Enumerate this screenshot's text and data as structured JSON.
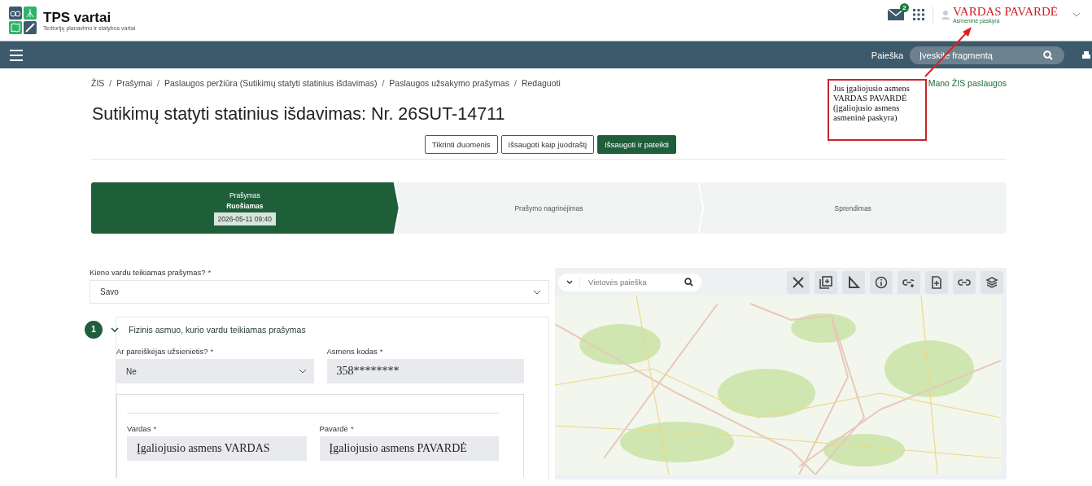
{
  "header": {
    "logo_title": "TPS vartai",
    "logo_subtitle": "Teritorijų planavimo ir statybos vartai",
    "messages_badge": "2",
    "user_name": "VARDAS PAVARDĖ",
    "user_role": "Asmeninė paskyra"
  },
  "navbar": {
    "search_label": "Paieška",
    "search_placeholder": "Įveskite fragmentą"
  },
  "breadcrumbs": [
    "ŽIS",
    "Prašymai",
    "Paslaugos peržiūra (Sutikimų statyti statinius išdavimas)",
    "Paslaugos užsakymo prašymas",
    "Redaguoti"
  ],
  "breadcrumb_separator": "/",
  "side_link": "Mano ŽIS paslaugos",
  "title": "Sutikimų statyti statinius išdavimas: Nr. 26SUT-14711",
  "buttons": [
    {
      "label": "Tikrinti duomenis",
      "kind": "outline"
    },
    {
      "label": "Išsaugoti kaip juodraštį",
      "kind": "outline"
    },
    {
      "label": "Išsaugoti ir pateikti",
      "kind": "primary"
    }
  ],
  "steps": [
    {
      "title": "Prašymas",
      "status": "Ruošiamas",
      "date": "2026-05-11 09:40",
      "selected": true
    },
    {
      "title": "Prašymo nagrinėjimas",
      "selected": false
    },
    {
      "title": "Sprendimas",
      "selected": false
    }
  ],
  "form": {
    "applicant": {
      "label": "Kieno vardu teikiamas prašymas?",
      "mark": "*",
      "value": "Savo"
    },
    "section": {
      "number": "1",
      "title": "Fizinis asmuo, kurio vardu teikiamas prašymas",
      "expanded": true,
      "fields": [
        {
          "label": "Ar pareiškėjas užsienietis?",
          "mark": "*",
          "value": "Ne",
          "kind": "select"
        },
        {
          "label": "Asmens kodas",
          "mark": "*",
          "value": "358********",
          "kind": "text"
        }
      ],
      "subfields": [
        {
          "label": "Vardas",
          "mark": "*",
          "value": "Įgaliojusio asmens VARDAS",
          "kind": "text"
        },
        {
          "label": "Pavardė",
          "mark": "*",
          "value": "Įgaliojusio asmens PAVARDĖ",
          "kind": "text"
        }
      ]
    }
  },
  "map": {
    "search_placeholder": "Vietovės paieška"
  },
  "annotation": {
    "text": "Jus įgaliojusio asmens VARDAS PAVARDĖ (įgaliojusio asmens asmeninė paskyra)"
  }
}
